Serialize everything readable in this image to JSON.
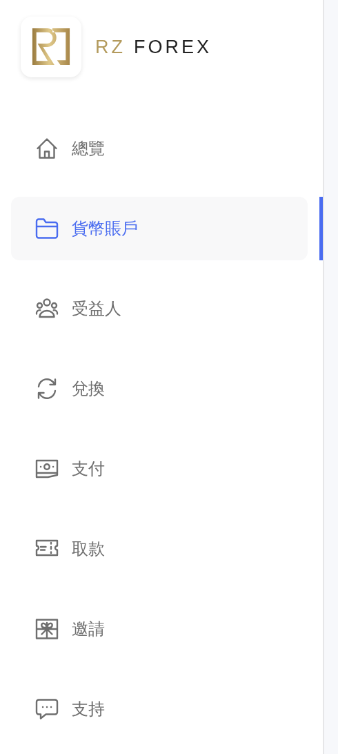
{
  "brand": {
    "prefix": "RZ",
    "name": "FOREX"
  },
  "nav": [
    {
      "label": "總覽",
      "selected": false
    },
    {
      "label": "貨幣賬戶",
      "selected": true
    },
    {
      "label": "受益人",
      "selected": false
    },
    {
      "label": "兌換",
      "selected": false
    },
    {
      "label": "支付",
      "selected": false
    },
    {
      "label": "取款",
      "selected": false
    },
    {
      "label": "邀請",
      "selected": false
    },
    {
      "label": "支持",
      "selected": false
    }
  ]
}
